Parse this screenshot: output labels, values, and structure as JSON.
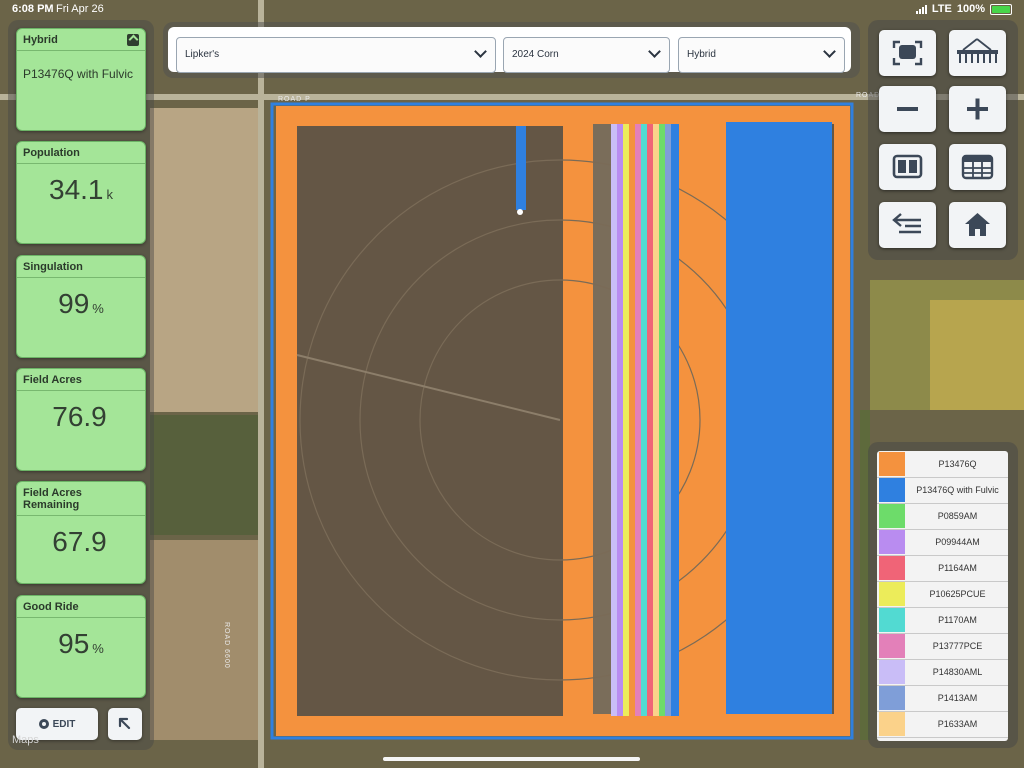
{
  "status_bar": {
    "time": "6:08 PM",
    "date": "Fri Apr 26",
    "network": "LTE",
    "battery": "100%"
  },
  "map": {
    "road_labels": [
      "ROAD P",
      "ROAD",
      "ROAD 6600"
    ],
    "watermark": "Maps"
  },
  "metrics": [
    {
      "title": "Hybrid",
      "value": "P13476Q with Fulvic",
      "unit": ""
    },
    {
      "title": "Population",
      "value": "34.1",
      "unit": "k"
    },
    {
      "title": "Singulation",
      "value": "99",
      "unit": "%"
    },
    {
      "title": "Field Acres",
      "value": "76.9",
      "unit": ""
    },
    {
      "title": "Field Acres Remaining",
      "value": "67.9",
      "unit": ""
    },
    {
      "title": "Good Ride",
      "value": "95",
      "unit": "%"
    }
  ],
  "buttons": {
    "edit_label": "EDIT"
  },
  "selectors": [
    {
      "label": "Lipker's"
    },
    {
      "label": "2024 Corn"
    },
    {
      "label": "Hybrid"
    }
  ],
  "tools": [
    {
      "icon": "center-focus-icon"
    },
    {
      "icon": "planter-icon"
    },
    {
      "icon": "zoom-out-icon"
    },
    {
      "icon": "zoom-in-icon"
    },
    {
      "icon": "split-view-icon"
    },
    {
      "icon": "table-icon"
    },
    {
      "icon": "layers-list-icon"
    },
    {
      "icon": "home-icon"
    }
  ],
  "legend": [
    {
      "name": "P13476Q",
      "color": "#f4923e"
    },
    {
      "name": "P13476Q with Fulvic",
      "color": "#2f80e0"
    },
    {
      "name": "P0859AM",
      "color": "#6ddc6a"
    },
    {
      "name": "P09944AM",
      "color": "#b98cf0"
    },
    {
      "name": "P1164AM",
      "color": "#f06477"
    },
    {
      "name": "P10625PCUE",
      "color": "#ecec5a"
    },
    {
      "name": "P1170AM",
      "color": "#52dad2"
    },
    {
      "name": "P13777PCE",
      "color": "#e380b9"
    },
    {
      "name": "P14830AML",
      "color": "#c9bdf7"
    },
    {
      "name": "P1413AM",
      "color": "#7f9ed8"
    },
    {
      "name": "P1633AM",
      "color": "#fbd28a"
    }
  ]
}
